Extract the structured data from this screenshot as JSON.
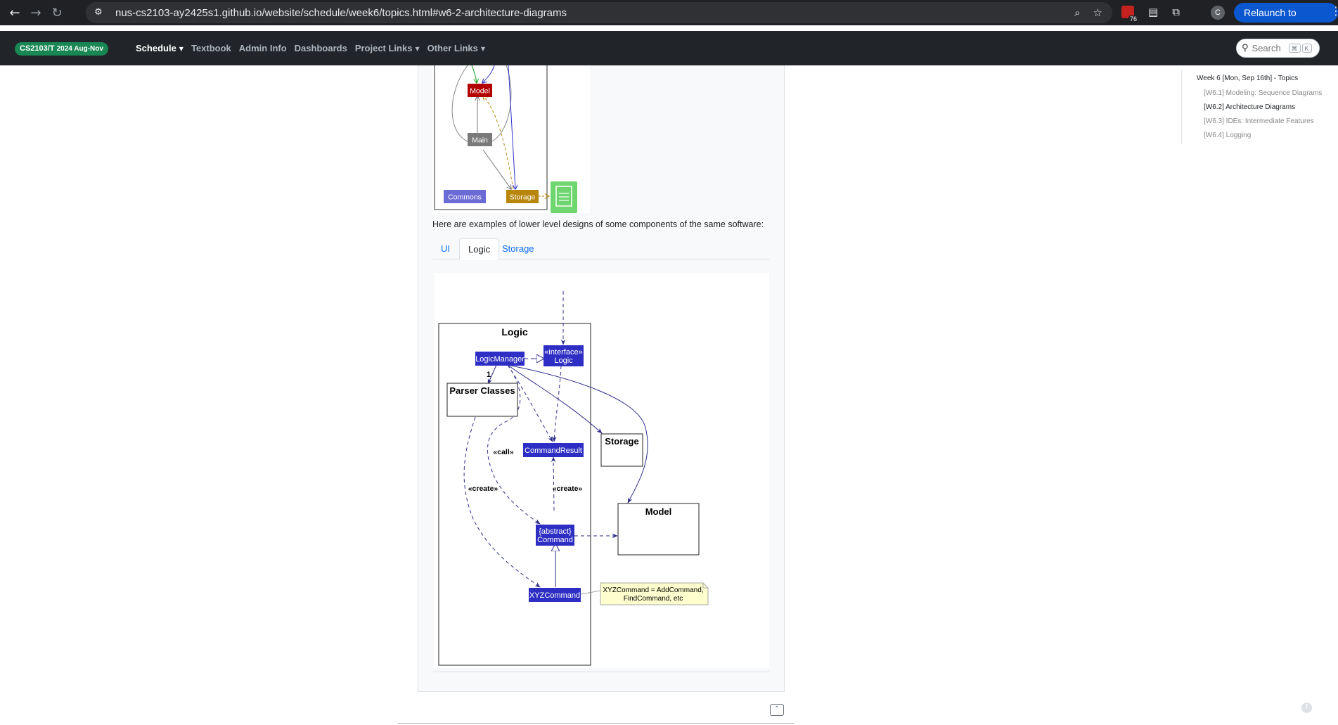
{
  "browser": {
    "url": "nus-cs2103-ay2425s1.github.io/website/schedule/week6/topics.html#w6-2-architecture-diagrams",
    "relaunch_label": "Relaunch to update",
    "avatar_letter": "C",
    "badge_count": "76"
  },
  "navbar": {
    "brand": "CS2103/T",
    "brand_sub": "2024 Aug-Nov",
    "items": [
      {
        "label": "Schedule",
        "dropdown": true
      },
      {
        "label": "Textbook",
        "dropdown": false
      },
      {
        "label": "Admin Info",
        "dropdown": false
      },
      {
        "label": "Dashboards",
        "dropdown": false
      },
      {
        "label": "Project Links",
        "dropdown": true
      },
      {
        "label": "Other Links",
        "dropdown": true
      }
    ],
    "search_placeholder": "Search",
    "search_kbd_1": "⌘",
    "search_kbd_2": "K"
  },
  "top_diagram": {
    "model_label": "Model",
    "main_label": "Main",
    "commons_label": "Commons",
    "storage_label": "Storage"
  },
  "content": {
    "intro": "Here are examples of lower level designs of some components of the same software:",
    "tabs": [
      "UI",
      "Logic",
      "Storage"
    ],
    "active_tab": "Logic"
  },
  "logic_diagram": {
    "package_title": "Logic",
    "logic_manager": "LogicManager",
    "interface_stereo": "«interface»",
    "interface_name": "Logic",
    "multiplicity": "1",
    "parser_classes": "Parser Classes",
    "command_result": "CommandResult",
    "storage": "Storage",
    "model": "Model",
    "call_label": "«call»",
    "create_label_left": "«create»",
    "create_label_right": "«create»",
    "abstract_stereo": "{abstract}",
    "abstract_name": "Command",
    "xyz_command": "XYZCommand",
    "note_line1": "XYZCommand = AddCommand,",
    "note_line2": "FindCommand, etc"
  },
  "toc": {
    "title": "Week 6 [Mon, Sep 16th] - Topics",
    "items": [
      {
        "label": "[W6.1] Modeling: Sequence Diagrams",
        "active": false
      },
      {
        "label": "[W6.2] Architecture Diagrams",
        "active": true
      },
      {
        "label": "[W6.3] IDEs: Intermediate Features",
        "active": false
      },
      {
        "label": "[W6.4] Logging",
        "active": false
      }
    ]
  },
  "colors": {
    "brand_green": "#198754",
    "class_blue": "#2e2ec4",
    "model_red": "#b30000",
    "main_gray": "#7a7a7a",
    "commons_purple": "#6b6bd6",
    "storage_gold": "#b8860b",
    "file_green": "#6fd66f",
    "note_yellow": "#fefece"
  }
}
